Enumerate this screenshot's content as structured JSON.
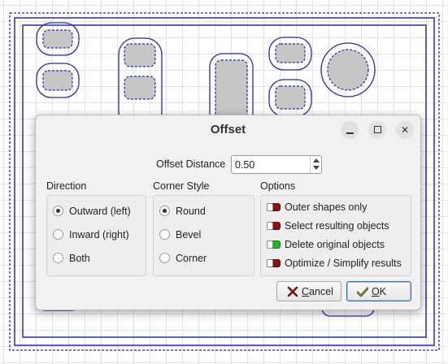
{
  "dialog": {
    "title": "Offset",
    "window_buttons": {
      "minimize": "minimize-icon",
      "maximize": "maximize-icon",
      "close": "close-icon"
    },
    "offset_distance": {
      "label": "Offset Distance",
      "value": "0.50"
    },
    "direction": {
      "title": "Direction",
      "options": [
        {
          "label": "Outward (left)",
          "selected": true
        },
        {
          "label": "Inward (right)",
          "selected": false
        },
        {
          "label": "Both",
          "selected": false
        }
      ]
    },
    "corner_style": {
      "title": "Corner Style",
      "options": [
        {
          "label": "Round",
          "selected": true
        },
        {
          "label": "Bevel",
          "selected": false
        },
        {
          "label": "Corner",
          "selected": false
        }
      ]
    },
    "options": {
      "title": "Options",
      "items": [
        {
          "label": "Outer shapes only",
          "enabled": false
        },
        {
          "label": "Select resulting objects",
          "enabled": false
        },
        {
          "label": "Delete original objects",
          "enabled": true
        },
        {
          "label": "Optimize / Simplify results",
          "enabled": false
        }
      ]
    },
    "buttons": {
      "cancel": {
        "mnemonic": "C",
        "rest": "ancel",
        "icon": "cancel-x-icon"
      },
      "ok": {
        "mnemonic": "O",
        "rest": "K",
        "icon": "ok-check-icon"
      }
    }
  },
  "colors": {
    "offset_path": "#2a2aa5",
    "shape_fill": "#c6c6c6",
    "toggle_off": "#8a1212",
    "toggle_on": "#1fb81f"
  }
}
